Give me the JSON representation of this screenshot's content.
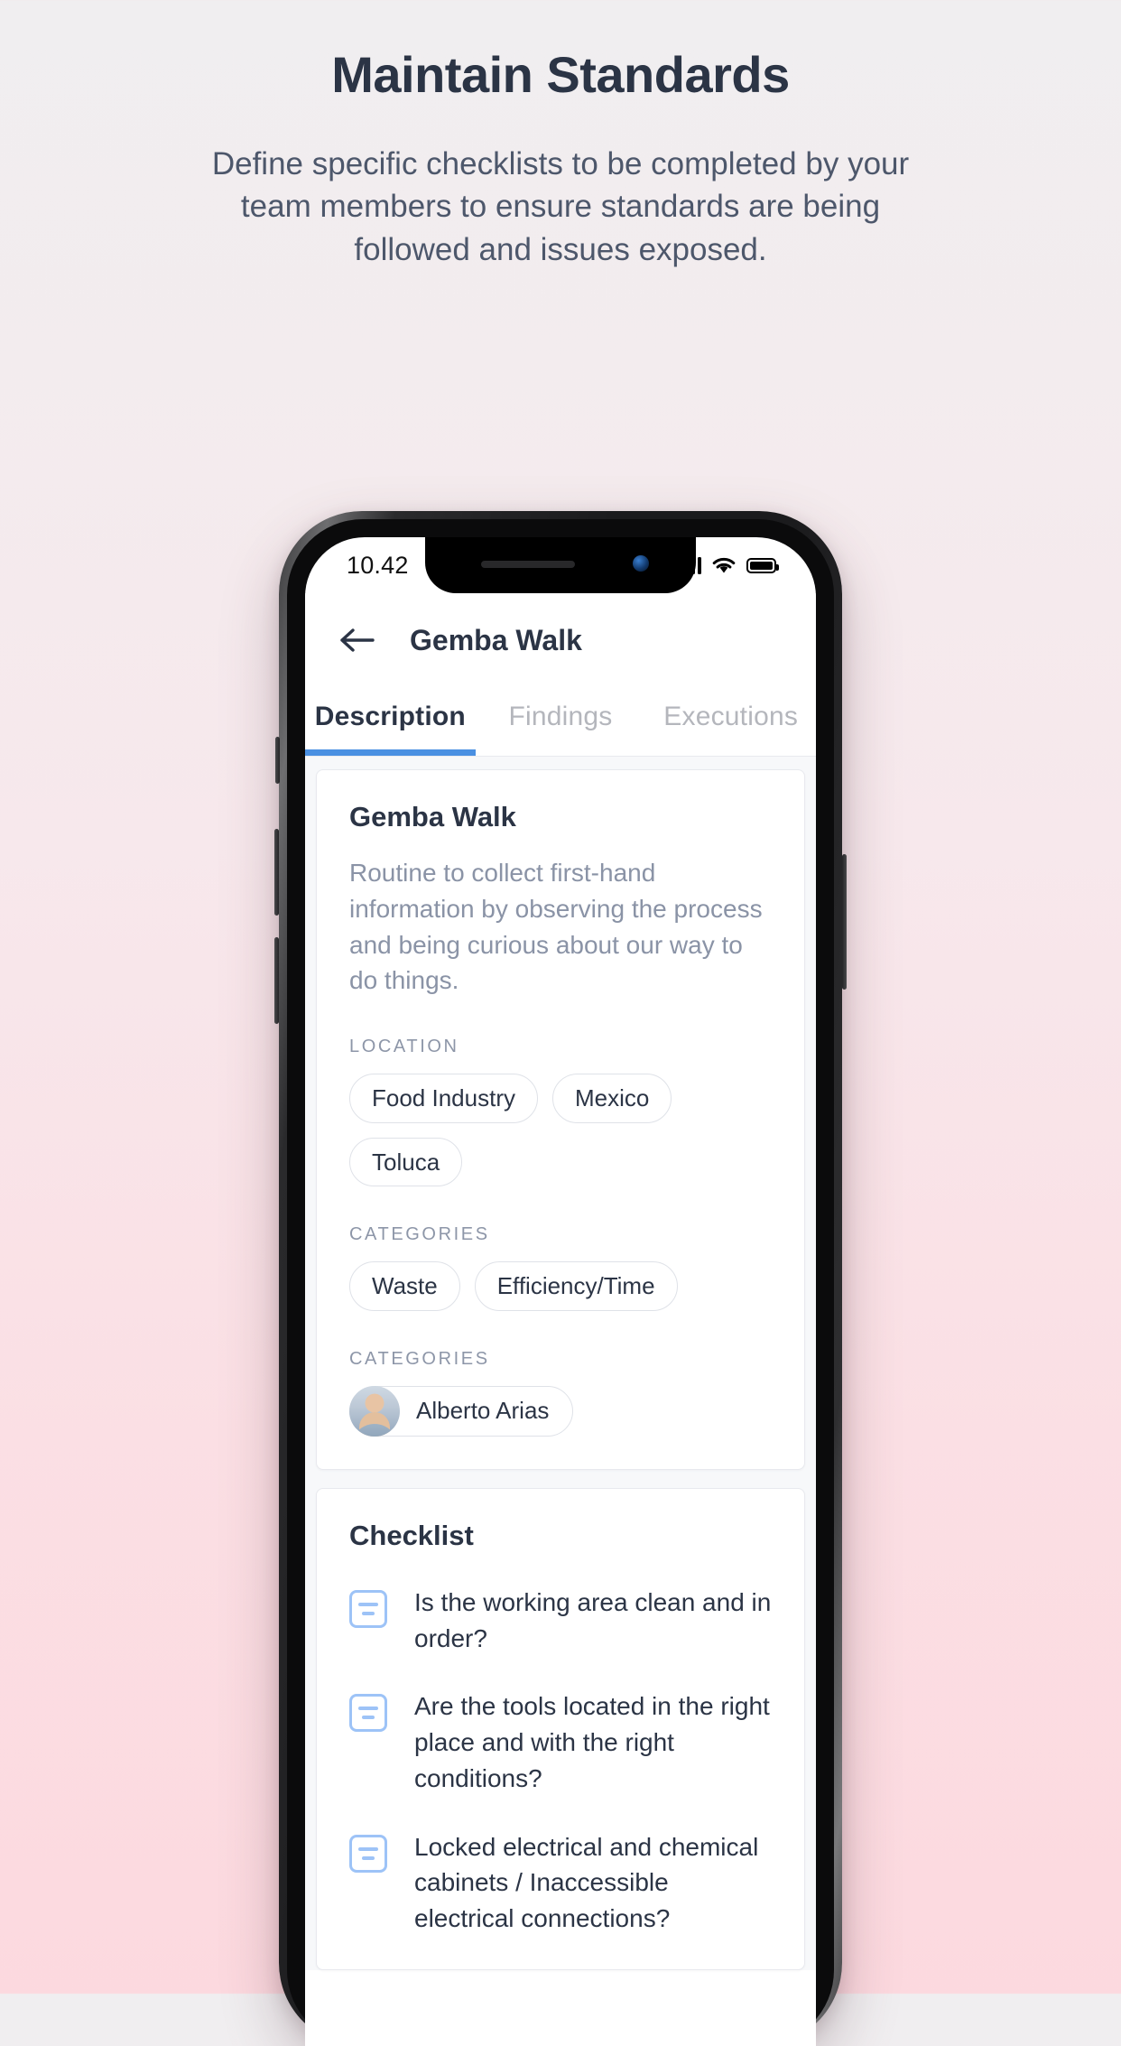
{
  "promo": {
    "title": "Maintain Standards",
    "subtitle": "Define specific checklists to be completed by your team members to ensure standards are being followed and issues exposed."
  },
  "status_bar": {
    "time": "10.42",
    "signal_icon": "cellular-signal-icon",
    "wifi_icon": "wifi-icon",
    "battery_icon": "battery-full-icon"
  },
  "app_header": {
    "back_icon": "back-arrow-icon",
    "title": "Gemba Walk"
  },
  "tabs": [
    {
      "label": "Description",
      "active": true
    },
    {
      "label": "Findings",
      "active": false
    },
    {
      "label": "Executions",
      "active": false
    }
  ],
  "description_card": {
    "title": "Gemba Walk",
    "body": "Routine to collect first-hand information by observing the process and being curious about our way to do things.",
    "sections": [
      {
        "label": "LOCATION",
        "chips": [
          "Food Industry",
          "Mexico",
          "Toluca"
        ]
      },
      {
        "label": "CATEGORIES",
        "chips": [
          "Waste",
          "Efficiency/Time"
        ]
      }
    ],
    "people_section": {
      "label": "CATEGORIES",
      "person": {
        "name": "Alberto Arias",
        "avatar_icon": "user-avatar"
      }
    }
  },
  "checklist_card": {
    "title": "Checklist",
    "items": [
      {
        "icon": "checklist-item-icon",
        "text": "Is the working area clean and in order?"
      },
      {
        "icon": "checklist-item-icon",
        "text": "Are the tools located in the right place and with the right conditions?"
      },
      {
        "icon": "checklist-item-icon",
        "text": "Locked electrical and chemical cabinets / Inaccessible electrical connections?"
      }
    ]
  },
  "colors": {
    "accent": "#4a90e2",
    "title": "#2b3445",
    "muted": "#8a93a6",
    "icon_blue": "#9dc3f7"
  }
}
